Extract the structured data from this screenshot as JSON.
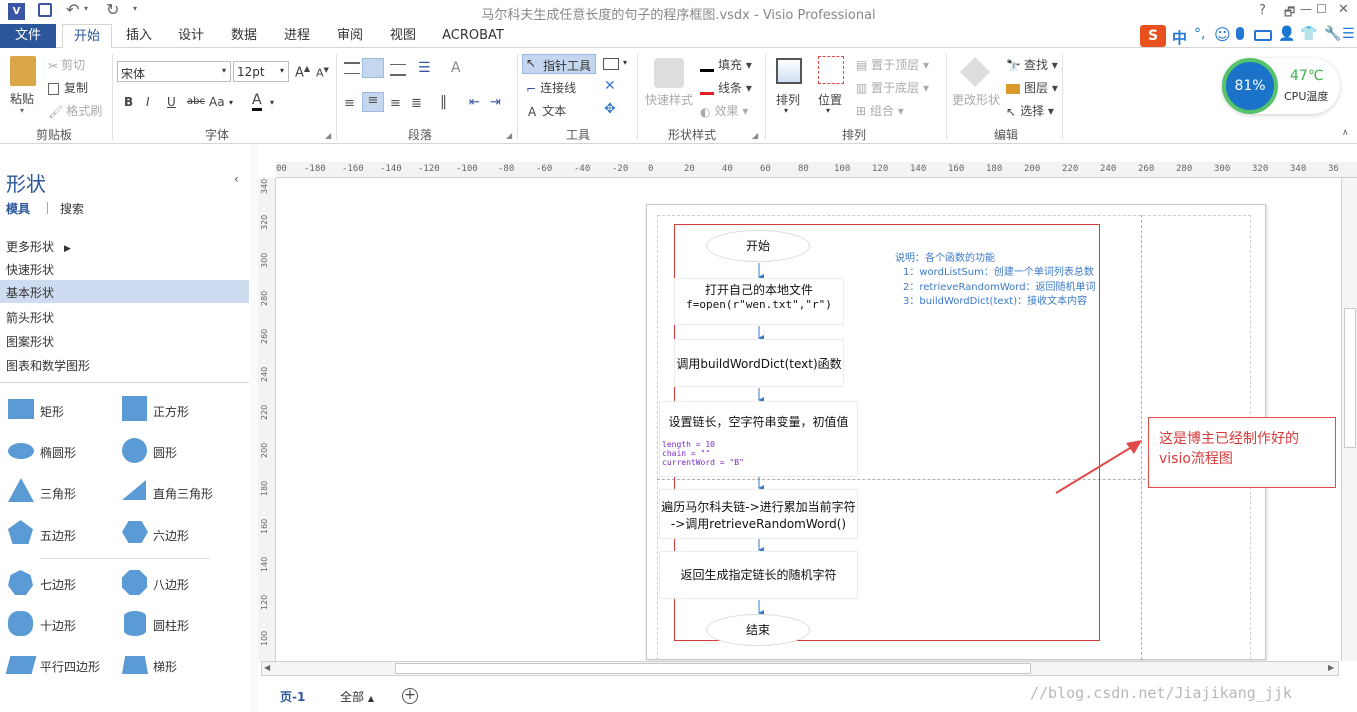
{
  "window": {
    "title": "马尔科夫生成任意长度的句子的程序框图.vsdx - Visio Professional",
    "help": "?",
    "controls": [
      "🗗",
      "—",
      "☐",
      "✕"
    ]
  },
  "tabs": [
    {
      "label": "文件"
    },
    {
      "label": "开始"
    },
    {
      "label": "插入"
    },
    {
      "label": "设计"
    },
    {
      "label": "数据"
    },
    {
      "label": "进程"
    },
    {
      "label": "审阅"
    },
    {
      "label": "视图"
    },
    {
      "label": "ACROBAT"
    }
  ],
  "ime": {
    "logo": "S",
    "lang": "中"
  },
  "ribbon": {
    "clipboard": {
      "paste": "粘贴",
      "cut": "剪切",
      "copy": "复制",
      "format_painter": "格式刷",
      "label": "剪贴板"
    },
    "font": {
      "name": "宋体",
      "size": "12pt",
      "bold": "B",
      "italic": "I",
      "underline": "U",
      "strike": "abc",
      "case": "Aa",
      "color": "A",
      "label": "字体"
    },
    "paragraph": {
      "label": "段落"
    },
    "tools": {
      "pointer": "指针工具",
      "connector": "连接线",
      "text": "文本",
      "label": "工具"
    },
    "shape_styles": {
      "quick": "快速样式",
      "fill": "填充",
      "line": "线条",
      "effect": "效果",
      "label": "形状样式"
    },
    "arrange": {
      "arrange": "排列",
      "position": "位置",
      "front": "置于顶层",
      "back": "置于底层",
      "group": "组合",
      "label": "排列"
    },
    "editing": {
      "change_shape": "更改形状",
      "find": "查找",
      "layer": "图层",
      "select": "选择",
      "label": "编辑"
    }
  },
  "cpu": {
    "usage": "81%",
    "temp": "47℃",
    "label": "CPU温度"
  },
  "shapes_panel": {
    "title": "形状",
    "tab_stencil": "模具",
    "tab_search": "搜索",
    "more": "更多形状",
    "categories": [
      "快速形状",
      "基本形状",
      "箭头形状",
      "图案形状",
      "图表和数学图形"
    ],
    "shapes": [
      "矩形",
      "正方形",
      "椭圆形",
      "圆形",
      "三角形",
      "直角三角形",
      "五边形",
      "六边形",
      "七边形",
      "八边形",
      "十边形",
      "圆柱形",
      "平行四边形",
      "梯形"
    ]
  },
  "ruler": {
    "h": [
      "00",
      "-180",
      "-160",
      "-140",
      "-120",
      "-100",
      "-80",
      "-60",
      "-40",
      "-20",
      "0",
      "20",
      "40",
      "60",
      "80",
      "100",
      "120",
      "140",
      "160",
      "180",
      "200",
      "220",
      "240",
      "260",
      "280",
      "300",
      "320",
      "340",
      "36"
    ],
    "v": [
      "340",
      "320",
      "300",
      "280",
      "260",
      "240",
      "220",
      "200",
      "180",
      "160",
      "140",
      "120",
      "100"
    ]
  },
  "flowchart": {
    "start": "开始",
    "step1_line1": "打开自己的本地文件",
    "step1_line2": "f=open(r\"wen.txt\",\"r\")",
    "step2": "调用buildWordDict(text)函数",
    "step3": "设置链长，空字符串变量，初值值",
    "code1": "length = 10",
    "code2": "chain = \"\"",
    "code3": "currentWord = \"B\"",
    "step4_line1": "遍历马尔科夫链->进行累加当前字符",
    "step4_line2": "->调用retrieveRandomWord()",
    "step5": "返回生成指定链长的随机字符",
    "end": "结束"
  },
  "notes": {
    "title": "说明：各个函数的功能",
    "n1": "1：wordListSum：创建一个单词列表总数",
    "n2": "2：retrieveRandomWord：返回随机单词",
    "n3": "3：buildWordDict(text)：接收文本内容"
  },
  "callout": {
    "line1": "这是博主已经制作好的",
    "line2": "visio流程图"
  },
  "status": {
    "page_tab": "页-1",
    "all": "全部",
    "watermark": "//blog.csdn.net/Jiajikang_jjk"
  },
  "colors": {
    "accent": "#2b579a",
    "callout_red": "#e04a4a",
    "note_blue": "#3b7ac9"
  }
}
